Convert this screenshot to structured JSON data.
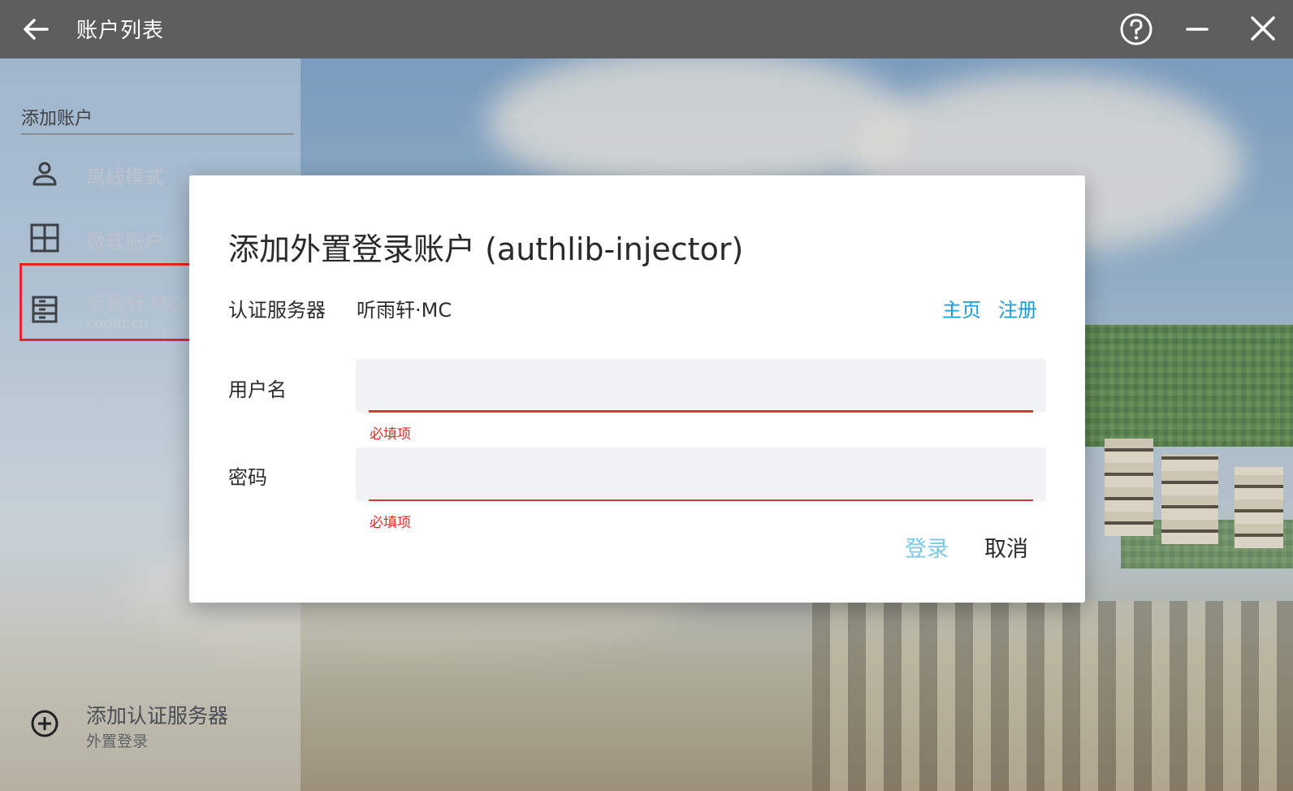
{
  "window": {
    "title": "账户列表"
  },
  "icons": {
    "back": "arrow-left-icon",
    "help": "help-circle-icon",
    "minimize": "minimize-icon",
    "close": "close-icon",
    "offline": "person-icon",
    "microsoft": "grid-icon",
    "server": "server-icon",
    "add": "plus-circle-icon"
  },
  "sidebar": {
    "section_title": "添加账户",
    "items": [
      {
        "label": "离线模式",
        "sub": ""
      },
      {
        "label": "微软账户",
        "sub": ""
      },
      {
        "label": "听雨轩·MC",
        "sub": "cndar.cn"
      }
    ],
    "add_server": {
      "label": "添加认证服务器",
      "sub": "外置登录"
    }
  },
  "dialog": {
    "title": "添加外置登录账户 (authlib-injector)",
    "server_label": "认证服务器",
    "server_name": "听雨轩·MC",
    "link_home": "主页",
    "link_register": "注册",
    "username_label": "用户名",
    "username_value": "",
    "username_error": "必填项",
    "password_label": "密码",
    "password_value": "",
    "password_error": "必填项",
    "login_button": "登录",
    "cancel_button": "取消"
  },
  "colors": {
    "titlebar": "#5d5d5d",
    "accent": "#1a9bd6",
    "login_disabled": "#7cc8e8",
    "error": "#dc2b24",
    "highlight": "#e2262b"
  }
}
